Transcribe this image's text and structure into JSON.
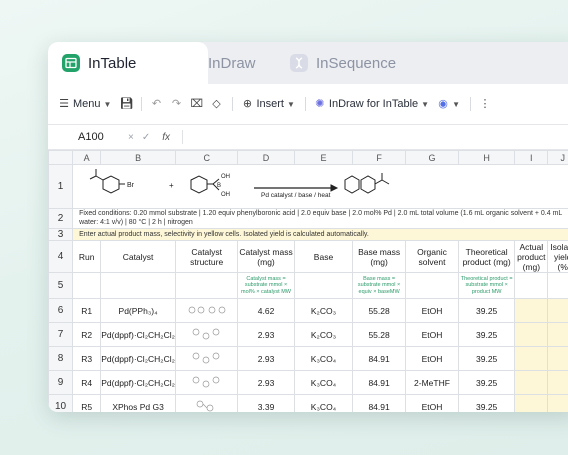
{
  "tabs": [
    {
      "label": "InTable",
      "icon": "table-icon"
    },
    {
      "label": "InDraw",
      "icon": "gear-icon"
    },
    {
      "label": "InSequence",
      "icon": "dna-icon"
    }
  ],
  "toolbar": {
    "menu_label": "Menu",
    "insert_label": "Insert",
    "indraw_label": "InDraw for InTable"
  },
  "formula_bar": {
    "cell_ref": "A100",
    "cancel": "×",
    "confirm": "✓",
    "fx": "fx"
  },
  "columns": [
    "A",
    "B",
    "C",
    "D",
    "E",
    "F",
    "G",
    "H",
    "I",
    "J"
  ],
  "reaction": {
    "label": "Pd catalyst / base / heat",
    "plus1": "+",
    "plus2": "+",
    "br": "Br",
    "oh1": "OH",
    "oh2": "OH",
    "boron": "B"
  },
  "conditions": "Fixed conditions: 0.20 mmol substrate | 1.20 equiv phenylboronic acid | 2.0 equiv base | 2.0 mol% Pd | 2.0 mL total volume (1.6 mL organic solvent + 0.4 mL water: 4:1 v/v) | 80 °C | 2 h | nitrogen",
  "note": "Enter actual product mass, selectivity in yellow cells. Isolated yield is calculated automatically.",
  "headers": [
    "Run",
    "Catalyst",
    "Catalyst structure",
    "Catalyst mass (mg)",
    "Base",
    "Base mass (mg)",
    "Organic solvent",
    "Theoretical product (mg)",
    "Actual product (mg)",
    "Isolate yield (%"
  ],
  "formulas": {
    "catalyst_mass": "Catalyst mass = substrate mmol × mol% × catalyst MW",
    "base_mass": "Base mass = substrate mmol × equiv × baseMW",
    "theoretical": "Theoretical product = substrate mmol × product MW"
  },
  "rows": [
    {
      "num": "6",
      "run": "R1",
      "catalyst": "Pd(PPh₃)₄",
      "mass": "4.62",
      "base": "K₂CO₃",
      "base_mass": "55.28",
      "solvent": "EtOH",
      "theo": "39.25"
    },
    {
      "num": "7",
      "run": "R2",
      "catalyst": "Pd(dppf)·Cl₂CH₂Cl₂",
      "mass": "2.93",
      "base": "K₂CO₃",
      "base_mass": "55.28",
      "solvent": "EtOH",
      "theo": "39.25"
    },
    {
      "num": "8",
      "run": "R3",
      "catalyst": "Pd(dppf)·Cl₂CH₂Cl₂",
      "mass": "2.93",
      "base": "K₃CO₄",
      "base_mass": "84.91",
      "solvent": "EtOH",
      "theo": "39.25"
    },
    {
      "num": "9",
      "run": "R4",
      "catalyst": "Pd(dppf)·Cl₂CH₂Cl₂",
      "mass": "2.93",
      "base": "K₃CO₄",
      "base_mass": "84.91",
      "solvent": "2-MeTHF",
      "theo": "39.25"
    },
    {
      "num": "10",
      "run": "R5",
      "catalyst": "XPhos Pd G3",
      "mass": "3.39",
      "base": "K₃CO₄",
      "base_mass": "84.91",
      "solvent": "EtOH",
      "theo": "39.25"
    }
  ],
  "row_numbers": {
    "r1": "1",
    "r2": "2",
    "r3": "3",
    "r4": "4",
    "r5": "5"
  },
  "colors": {
    "accent": "#23a36a",
    "yellow_cell": "#fdf7d8",
    "formula_text": "#2c9b6a"
  }
}
